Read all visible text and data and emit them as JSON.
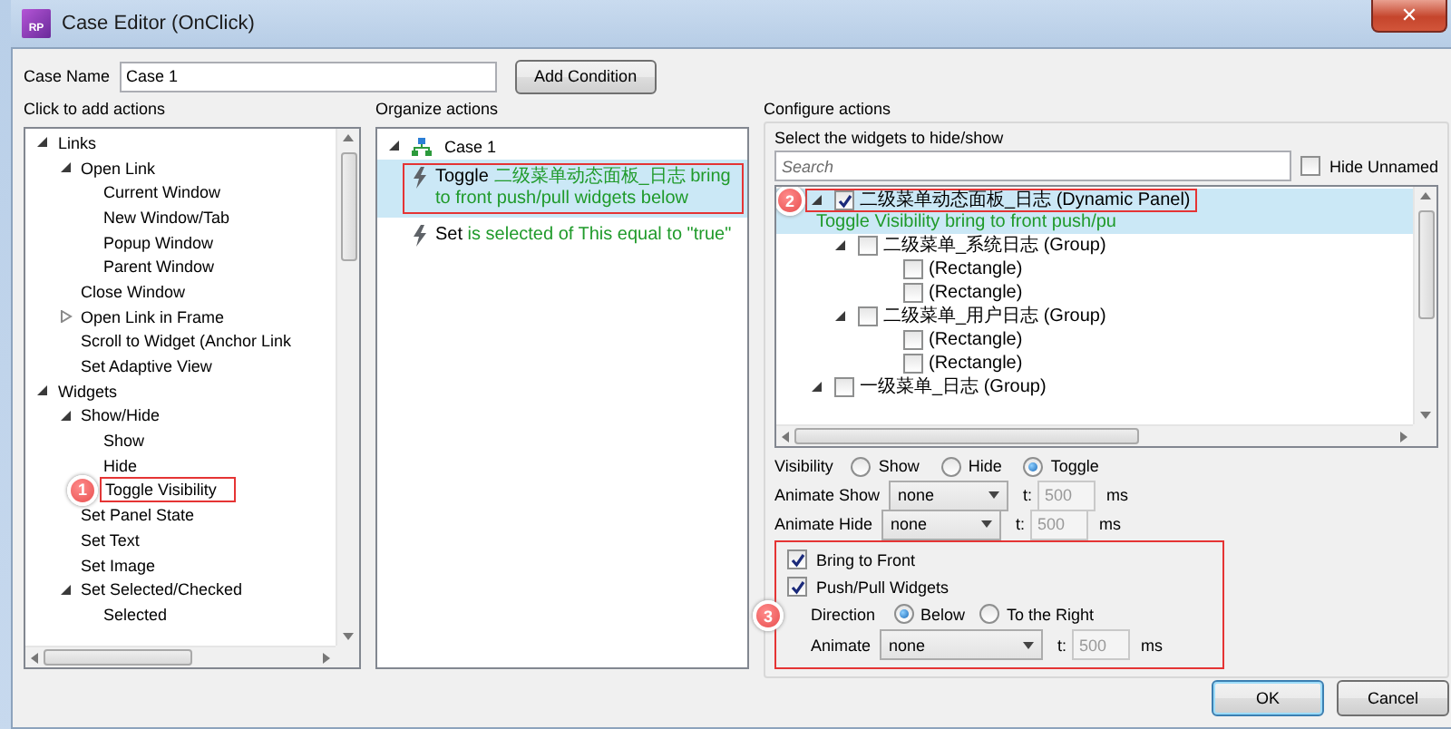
{
  "window": {
    "title": "Case Editor (OnClick)",
    "icon_label": "RP",
    "close_glyph": "✕"
  },
  "case_name": {
    "label": "Case Name",
    "value": "Case 1",
    "button": "Add Condition"
  },
  "add_actions": {
    "title": "Click to add actions",
    "tree": [
      {
        "label": "Links",
        "expanded": true,
        "children": [
          {
            "label": "Open Link",
            "expanded": true,
            "children": [
              {
                "label": "Current Window"
              },
              {
                "label": "New Window/Tab"
              },
              {
                "label": "Popup Window"
              },
              {
                "label": "Parent Window"
              }
            ]
          },
          {
            "label": "Close Window"
          },
          {
            "label": "Open Link in Frame",
            "expanded": false
          },
          {
            "label": "Scroll to Widget (Anchor Link"
          },
          {
            "label": "Set Adaptive View"
          }
        ]
      },
      {
        "label": "Widgets",
        "expanded": true,
        "children": [
          {
            "label": "Show/Hide",
            "expanded": true,
            "children": [
              {
                "label": "Show"
              },
              {
                "label": "Hide"
              },
              {
                "label": "Toggle Visibility",
                "outlined": true,
                "badge": "1"
              }
            ]
          },
          {
            "label": "Set Panel State"
          },
          {
            "label": "Set Text"
          },
          {
            "label": "Set Image"
          },
          {
            "label": "Set Selected/Checked",
            "expanded": true,
            "children": [
              {
                "label": "Selected"
              }
            ]
          }
        ]
      }
    ]
  },
  "organize_actions": {
    "title": "Organize actions",
    "case": {
      "label": "Case 1",
      "expanded": true
    },
    "actions": [
      {
        "verb": "Toggle",
        "detail": "二级菜单动态面板_日志 bring to front push/pull widgets below",
        "selected": true,
        "outlined": true
      },
      {
        "verb": "Set",
        "detail": "is selected of This equal to \"true\"",
        "selected": false,
        "outlined": false
      }
    ]
  },
  "configure": {
    "title": "Configure actions",
    "widgets_label": "Select the widgets to hide/show",
    "search": {
      "placeholder": "Search"
    },
    "hide_unnamed": {
      "label": "Hide Unnamed",
      "checked": false
    },
    "widgets": [
      {
        "label": "二级菜单动态面板_日志 (Dynamic Panel)",
        "note": "Toggle Visibility bring to front push/pu",
        "checked": true,
        "selected": true,
        "expanded": true,
        "outlined": true,
        "badge": "2",
        "children": [
          {
            "label": "二级菜单_系统日志 (Group)",
            "checked": false,
            "selected": false,
            "expanded": true,
            "children": [
              {
                "label": "(Rectangle)",
                "checked": false,
                "selected": false
              },
              {
                "label": "(Rectangle)",
                "checked": false,
                "selected": false
              }
            ]
          },
          {
            "label": "二级菜单_用户日志 (Group)",
            "checked": false,
            "selected": false,
            "expanded": true,
            "children": [
              {
                "label": "(Rectangle)",
                "checked": false,
                "selected": false
              },
              {
                "label": "(Rectangle)",
                "checked": false,
                "selected": false
              }
            ]
          }
        ]
      },
      {
        "label": "一级菜单_日志 (Group)",
        "checked": false,
        "selected": false,
        "expanded": true
      }
    ],
    "visibility": {
      "label": "Visibility",
      "options": [
        {
          "label": "Show",
          "selected": false
        },
        {
          "label": "Hide",
          "selected": false
        },
        {
          "label": "Toggle",
          "selected": true
        }
      ]
    },
    "animate_show": {
      "label": "Animate Show",
      "value": "none",
      "t_label": "t:",
      "time": "500",
      "time_disabled": true,
      "unit": "ms"
    },
    "animate_hide": {
      "label": "Animate Hide",
      "value": "none",
      "t_label": "t:",
      "time": "500",
      "time_disabled": true,
      "unit": "ms"
    },
    "options_group": {
      "badge": "3",
      "outlined": true,
      "bring_to_front": {
        "label": "Bring to Front",
        "checked": true
      },
      "push_pull": {
        "label": "Push/Pull Widgets",
        "checked": true
      },
      "direction": {
        "label": "Direction",
        "options": [
          {
            "label": "Below",
            "selected": true
          },
          {
            "label": "To the Right",
            "selected": false
          }
        ]
      },
      "animate": {
        "label": "Animate",
        "value": "none",
        "t_label": "t:",
        "time": "500",
        "time_disabled": true,
        "unit": "ms"
      }
    }
  },
  "buttons": [
    {
      "label": "OK",
      "default": true
    },
    {
      "label": "Cancel",
      "default": false
    }
  ]
}
